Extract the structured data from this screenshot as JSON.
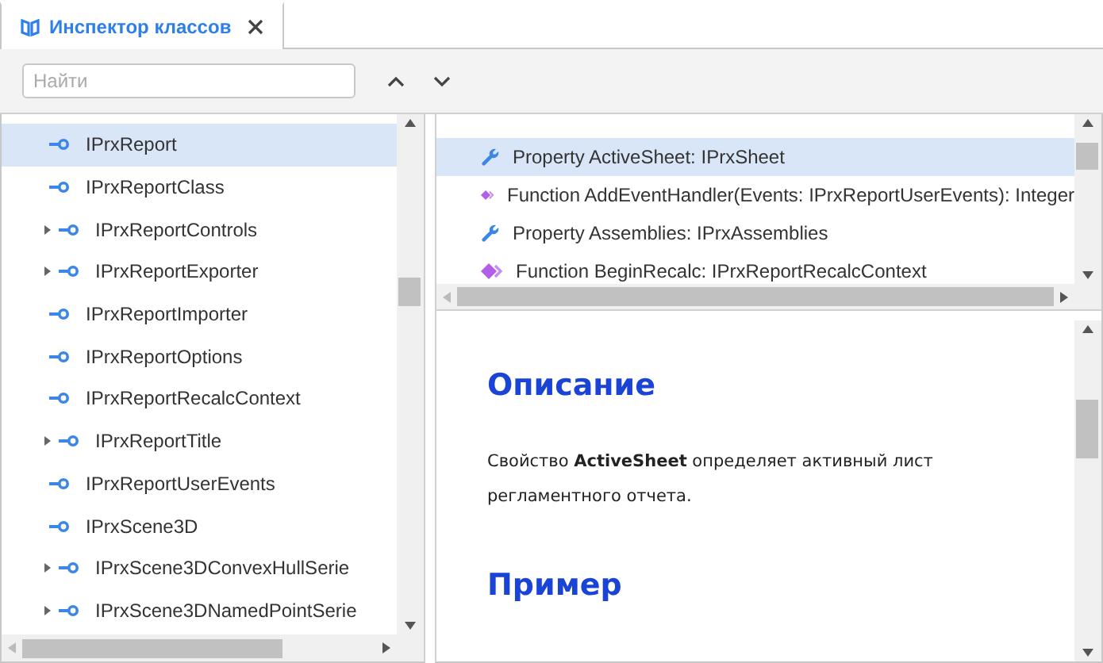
{
  "tab": {
    "title": "Инспектор классов",
    "selected": true
  },
  "search": {
    "placeholder": "Найти"
  },
  "tree": [
    {
      "label": "IPrxReport",
      "expandable": false,
      "selected": true
    },
    {
      "label": "IPrxReportClass",
      "expandable": false,
      "selected": false
    },
    {
      "label": "IPrxReportControls",
      "expandable": true,
      "selected": false
    },
    {
      "label": "IPrxReportExporter",
      "expandable": true,
      "selected": false
    },
    {
      "label": "IPrxReportImporter",
      "expandable": false,
      "selected": false
    },
    {
      "label": "IPrxReportOptions",
      "expandable": false,
      "selected": false
    },
    {
      "label": "IPrxReportRecalcContext",
      "expandable": false,
      "selected": false
    },
    {
      "label": "IPrxReportTitle",
      "expandable": true,
      "selected": false
    },
    {
      "label": "IPrxReportUserEvents",
      "expandable": false,
      "selected": false
    },
    {
      "label": "IPrxScene3D",
      "expandable": false,
      "selected": false
    },
    {
      "label": "IPrxScene3DConvexHullSerie",
      "expandable": true,
      "selected": false
    },
    {
      "label": "IPrxScene3DNamedPointSerie",
      "expandable": true,
      "selected": false
    }
  ],
  "members": [
    {
      "kind": "property",
      "label": "Property ActiveSheet: IPrxSheet",
      "selected": true
    },
    {
      "kind": "function",
      "label": "Function AddEventHandler(Events: IPrxReportUserEvents): Integer",
      "selected": false
    },
    {
      "kind": "property",
      "label": "Property Assemblies: IPrxAssemblies",
      "selected": false
    },
    {
      "kind": "function",
      "label": "Function BeginRecalc: IPrxReportRecalcContext",
      "selected": false
    }
  ],
  "doc": [
    {
      "kind": "heading",
      "text": "Описание"
    },
    {
      "kind": "paragraph",
      "text": "Свойство **ActiveSheet** определяет активный лист регламентного отчета."
    },
    {
      "kind": "heading",
      "text": "Пример"
    }
  ]
}
